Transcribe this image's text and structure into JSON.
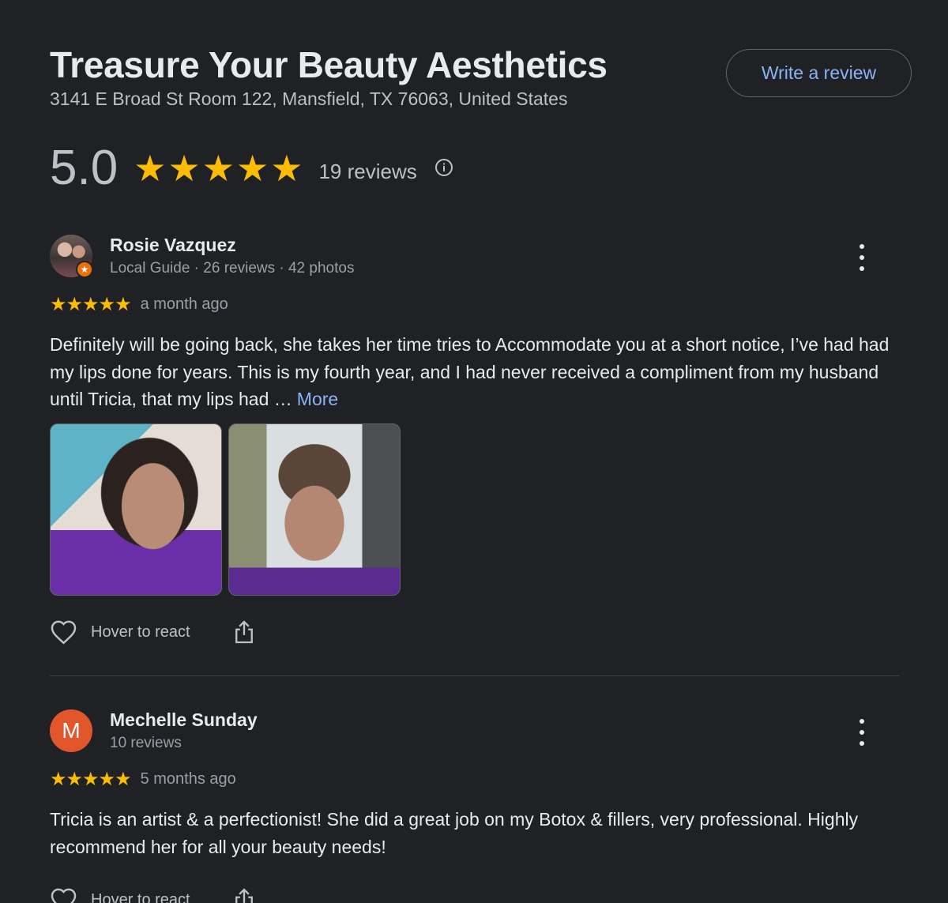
{
  "business": {
    "name": "Treasure Your Beauty Aesthetics",
    "address": "3141 E Broad St Room 122, Mansfield, TX 76063, United States",
    "write_review_label": "Write a review",
    "rating": "5.0",
    "stars_shown": 5,
    "review_count": "19 reviews"
  },
  "colors": {
    "background": "#202124",
    "star": "#fbbc04",
    "link": "#8ab4f8",
    "avatar_letter_bg": "#e2562b",
    "local_guide_badge": "#e8710a"
  },
  "icons": {
    "info": "info-icon",
    "more_options": "kebab-menu-icon",
    "react": "heart-outline-icon",
    "share": "share-icon"
  },
  "reviews": [
    {
      "author": "Rosie Vazquez",
      "meta": "Local Guide · 26 reviews · 42 photos",
      "stars": 5,
      "time": "a month ago",
      "text": "Definitely will be going back, she takes her time tries to Accommodate you at a short notice, I’ve had had my lips done for years. This is my fourth year, and I had never received a compliment from my husband until Tricia, that my lips had …",
      "more_label": "More",
      "react_label": "Hover to react"
    },
    {
      "author": "Mechelle Sunday",
      "avatar_letter": "M",
      "meta": "10 reviews",
      "stars": 5,
      "time": "5 months ago",
      "text": "Tricia is an artist & a perfectionist! She did a great job on my Botox & fillers, very professional. Highly recommend her for all your beauty needs!",
      "react_label": "Hover to react"
    }
  ]
}
